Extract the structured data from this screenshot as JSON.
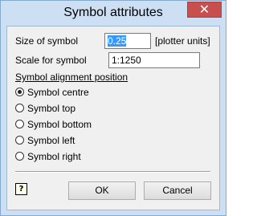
{
  "window": {
    "title": "Symbol attributes",
    "close_symbol": "✕"
  },
  "fields": {
    "size_label": "Size of symbol",
    "size_value": "0.25",
    "size_unit": "[plotter units]",
    "scale_label": "Scale for symbol",
    "scale_value": "1:1250"
  },
  "alignment": {
    "heading": "Symbol alignment position",
    "selected": "Symbol centre",
    "options": [
      {
        "label": "Symbol centre",
        "checked": true
      },
      {
        "label": "Symbol top",
        "checked": false
      },
      {
        "label": "Symbol bottom",
        "checked": false
      },
      {
        "label": "Symbol left",
        "checked": false
      },
      {
        "label": "Symbol right",
        "checked": false
      }
    ]
  },
  "buttons": {
    "help": "?",
    "ok": "OK",
    "cancel": "Cancel"
  },
  "icons": {
    "close": "close-icon",
    "help": "help-icon"
  }
}
